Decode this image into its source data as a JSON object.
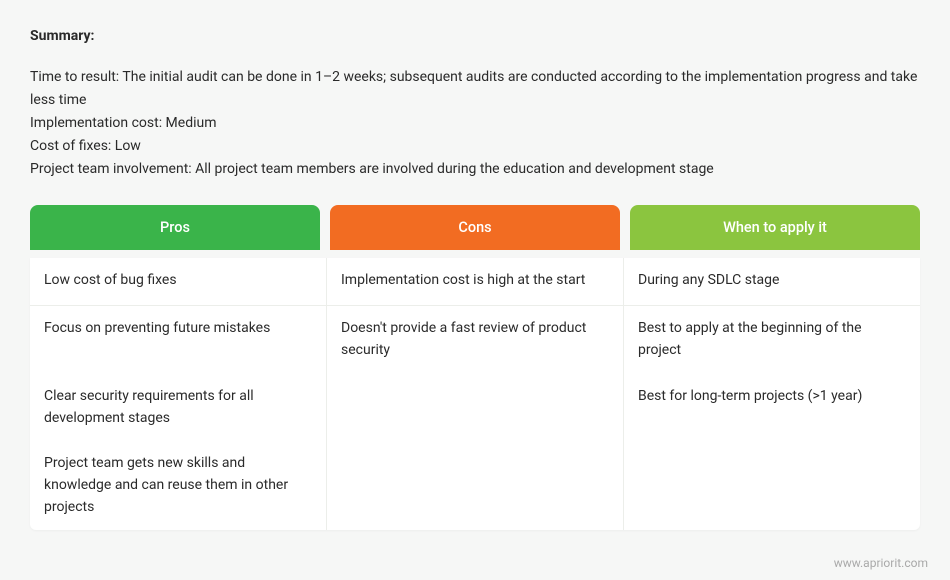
{
  "summary": {
    "title": "Summary:",
    "time_to_result": "Time to result: The initial audit can be done in 1–2 weeks; subsequent audits are conducted according to the implementation progress and take less time",
    "implementation_cost": "Implementation cost: Medium",
    "cost_of_fixes": "Cost of fixes: Low",
    "team_involvement": "Project team involvement: All project team members are involved during the education and development stage"
  },
  "table": {
    "headers": {
      "pros": "Pros",
      "cons": "Cons",
      "when": "When to apply it"
    },
    "rows": [
      {
        "pros": "Low cost of bug fixes",
        "cons": "Implementation cost is high at the start",
        "when": "During any SDLC stage"
      },
      {
        "pros": "Focus on preventing future mistakes",
        "cons": "Doesn't provide a fast review of product security",
        "when": "Best to apply at the beginning of the project"
      },
      {
        "pros": "Clear security requirements for all development stages",
        "cons": "",
        "when": "Best for long-term projects (>1 year)"
      },
      {
        "pros": "Project team gets new skills and knowledge and can reuse them in other projects",
        "cons": "",
        "when": ""
      }
    ]
  },
  "footer": {
    "link": "www.apriorit.com"
  }
}
